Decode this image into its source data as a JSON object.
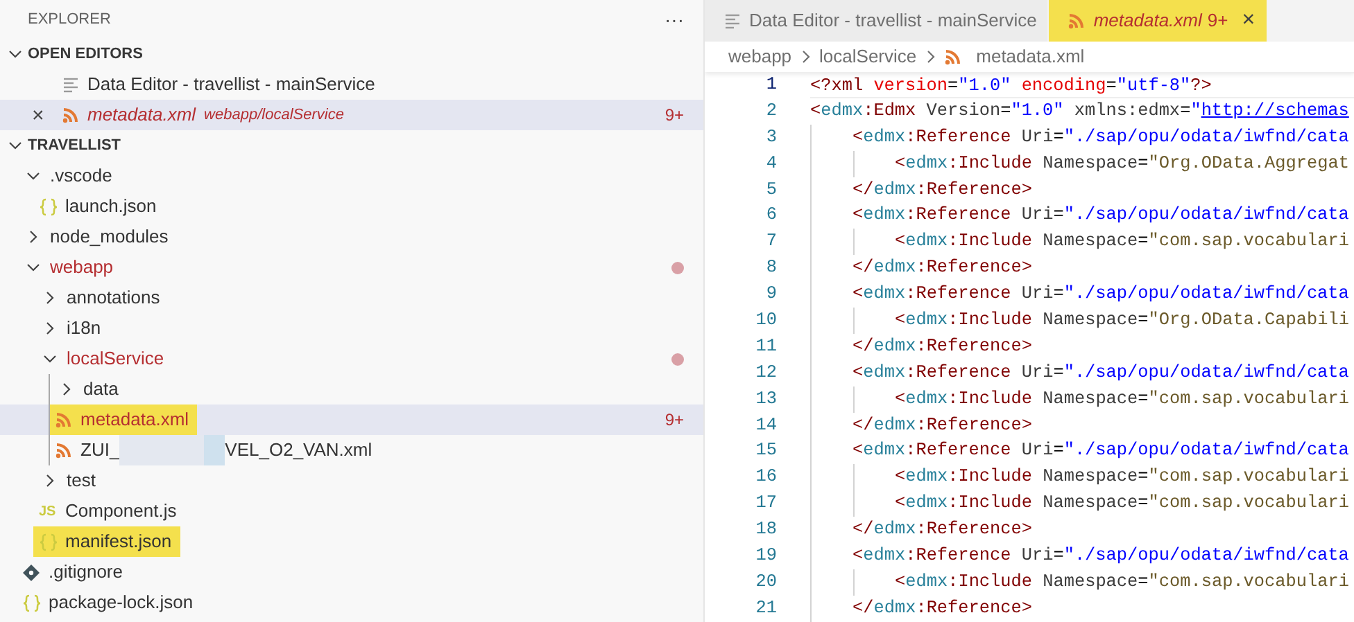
{
  "sidebar": {
    "title": "EXPLORER",
    "more": "···",
    "open_editors": {
      "title": "OPEN EDITORS",
      "expanded": true,
      "items": [
        {
          "label": "Data Editor - travellist - mainService",
          "kind": "data_editor",
          "selected": false,
          "italic": false,
          "problem": false
        },
        {
          "label": "metadata.xml",
          "description": "webapp/localService",
          "badge": "9+",
          "kind": "xml",
          "selected": true,
          "italic": true,
          "problem": true,
          "close": "×"
        }
      ]
    },
    "project": {
      "title": "TRAVELLIST",
      "expanded": true,
      "items": [
        {
          "label": ".vscode",
          "kind": "folder",
          "expanded": true,
          "children": [
            {
              "label": "launch.json",
              "kind": "json"
            }
          ]
        },
        {
          "label": "node_modules",
          "kind": "folder",
          "expanded": false
        },
        {
          "label": "webapp",
          "kind": "folder",
          "expanded": true,
          "problem": true,
          "modified": true,
          "children": [
            {
              "label": "annotations",
              "kind": "folder",
              "expanded": false
            },
            {
              "label": "i18n",
              "kind": "folder",
              "expanded": false
            },
            {
              "label": "localService",
              "kind": "folder",
              "expanded": true,
              "problem": true,
              "modified": true,
              "children": [
                {
                  "label": "data",
                  "kind": "folder",
                  "expanded": false
                },
                {
                  "label": "metadata.xml",
                  "kind": "xml",
                  "problem": true,
                  "selected": true,
                  "highlighted": true,
                  "badge": "9+"
                },
                {
                  "label": "ZUI_",
                  "label_after_redaction": "VEL_O2_VAN.xml",
                  "redacted": true,
                  "kind": "xml"
                }
              ]
            },
            {
              "label": "test",
              "kind": "folder",
              "expanded": false
            },
            {
              "label": "Component.js",
              "kind": "js",
              "icon_text": "JS"
            },
            {
              "label": "manifest.json",
              "kind": "json",
              "highlighted": true
            }
          ]
        },
        {
          "label": ".gitignore",
          "kind": "git"
        },
        {
          "label": "package-lock.json",
          "kind": "json"
        }
      ]
    }
  },
  "tabs": [
    {
      "label": "Data Editor - travellist - mainService",
      "kind": "data_editor",
      "selected": false
    },
    {
      "label": "metadata.xml",
      "badge": "9+",
      "kind": "xml",
      "selected": true,
      "italic": true,
      "highlighted": true,
      "close": "×"
    }
  ],
  "breadcrumb": [
    {
      "label": "webapp",
      "kind": "folder"
    },
    {
      "label": "localService",
      "kind": "folder"
    },
    {
      "label": "metadata.xml",
      "kind": "xml"
    }
  ],
  "editor": {
    "lines": [
      {
        "number": "1",
        "current": true,
        "kind": "root",
        "tokens": [
          {
            "kind": "br",
            "text": "<?"
          },
          {
            "kind": "tag",
            "text": "xml"
          },
          {
            "kind": "attr",
            "text": " version"
          },
          {
            "kind": "eq",
            "text": "="
          },
          {
            "kind": "str",
            "text": "\"1.0\""
          },
          {
            "kind": "attr",
            "text": " encoding"
          },
          {
            "kind": "eq",
            "text": "="
          },
          {
            "kind": "str",
            "text": "\"utf-8\""
          },
          {
            "kind": "br",
            "text": "?>"
          }
        ]
      },
      {
        "number": "2",
        "current": false,
        "kind": "root",
        "tokens": [
          {
            "kind": "pun",
            "text": "<"
          },
          {
            "kind": "ns",
            "text": "edmx"
          },
          {
            "kind": "tag",
            "text": ":Edmx"
          },
          {
            "kind": "attr2",
            "text": " Version"
          },
          {
            "kind": "eq",
            "text": "="
          },
          {
            "kind": "str",
            "text": "\"1.0\""
          },
          {
            "kind": "attr2",
            "text": " xmlns:edmx"
          },
          {
            "kind": "eq",
            "text": "="
          },
          {
            "kind": "str",
            "text": "\""
          },
          {
            "kind": "link",
            "text": "http://schemas"
          }
        ]
      },
      {
        "number": "3",
        "current": false,
        "kind": "nested",
        "tokens": [
          {
            "kind": "pun",
            "text": "<"
          },
          {
            "kind": "ns",
            "text": "edmx"
          },
          {
            "kind": "tag",
            "text": ":Reference"
          },
          {
            "kind": "attr2",
            "text": " Uri"
          },
          {
            "kind": "eq",
            "text": "="
          },
          {
            "kind": "str",
            "text": "\"./sap/opu/odata/iwfnd/cata"
          }
        ]
      },
      {
        "number": "4",
        "current": false,
        "kind": "nested2",
        "tokens": [
          {
            "kind": "pun",
            "text": "<"
          },
          {
            "kind": "ns",
            "text": "edmx"
          },
          {
            "kind": "tag",
            "text": ":Include"
          },
          {
            "kind": "attr2",
            "text": " Namespace"
          },
          {
            "kind": "eq",
            "text": "="
          },
          {
            "kind": "str2",
            "text": "\"Org.OData.Aggregat"
          }
        ]
      },
      {
        "number": "5",
        "current": false,
        "kind": "nested",
        "tokens": [
          {
            "kind": "pun",
            "text": "</"
          },
          {
            "kind": "ns",
            "text": "edmx"
          },
          {
            "kind": "tag",
            "text": ":Reference"
          },
          {
            "kind": "pun",
            "text": ">"
          }
        ]
      },
      {
        "number": "6",
        "current": false,
        "kind": "nested",
        "tokens": [
          {
            "kind": "pun",
            "text": "<"
          },
          {
            "kind": "ns",
            "text": "edmx"
          },
          {
            "kind": "tag",
            "text": ":Reference"
          },
          {
            "kind": "attr2",
            "text": " Uri"
          },
          {
            "kind": "eq",
            "text": "="
          },
          {
            "kind": "str",
            "text": "\"./sap/opu/odata/iwfnd/cata"
          }
        ]
      },
      {
        "number": "7",
        "current": false,
        "kind": "nested2",
        "tokens": [
          {
            "kind": "pun",
            "text": "<"
          },
          {
            "kind": "ns",
            "text": "edmx"
          },
          {
            "kind": "tag",
            "text": ":Include"
          },
          {
            "kind": "attr2",
            "text": " Namespace"
          },
          {
            "kind": "eq",
            "text": "="
          },
          {
            "kind": "str2",
            "text": "\"com.sap.vocabulari"
          }
        ]
      },
      {
        "number": "8",
        "current": false,
        "kind": "nested",
        "tokens": [
          {
            "kind": "pun",
            "text": "</"
          },
          {
            "kind": "ns",
            "text": "edmx"
          },
          {
            "kind": "tag",
            "text": ":Reference"
          },
          {
            "kind": "pun",
            "text": ">"
          }
        ]
      },
      {
        "number": "9",
        "current": false,
        "kind": "nested",
        "tokens": [
          {
            "kind": "pun",
            "text": "<"
          },
          {
            "kind": "ns",
            "text": "edmx"
          },
          {
            "kind": "tag",
            "text": ":Reference"
          },
          {
            "kind": "attr2",
            "text": " Uri"
          },
          {
            "kind": "eq",
            "text": "="
          },
          {
            "kind": "str",
            "text": "\"./sap/opu/odata/iwfnd/cata"
          }
        ]
      },
      {
        "number": "10",
        "current": false,
        "kind": "nested2",
        "tokens": [
          {
            "kind": "pun",
            "text": "<"
          },
          {
            "kind": "ns",
            "text": "edmx"
          },
          {
            "kind": "tag",
            "text": ":Include"
          },
          {
            "kind": "attr2",
            "text": " Namespace"
          },
          {
            "kind": "eq",
            "text": "="
          },
          {
            "kind": "str2",
            "text": "\"Org.OData.Capabili"
          }
        ]
      },
      {
        "number": "11",
        "current": false,
        "kind": "nested",
        "tokens": [
          {
            "kind": "pun",
            "text": "</"
          },
          {
            "kind": "ns",
            "text": "edmx"
          },
          {
            "kind": "tag",
            "text": ":Reference"
          },
          {
            "kind": "pun",
            "text": ">"
          }
        ]
      },
      {
        "number": "12",
        "current": false,
        "kind": "nested",
        "tokens": [
          {
            "kind": "pun",
            "text": "<"
          },
          {
            "kind": "ns",
            "text": "edmx"
          },
          {
            "kind": "tag",
            "text": ":Reference"
          },
          {
            "kind": "attr2",
            "text": " Uri"
          },
          {
            "kind": "eq",
            "text": "="
          },
          {
            "kind": "str",
            "text": "\"./sap/opu/odata/iwfnd/cata"
          }
        ]
      },
      {
        "number": "13",
        "current": false,
        "kind": "nested2",
        "tokens": [
          {
            "kind": "pun",
            "text": "<"
          },
          {
            "kind": "ns",
            "text": "edmx"
          },
          {
            "kind": "tag",
            "text": ":Include"
          },
          {
            "kind": "attr2",
            "text": " Namespace"
          },
          {
            "kind": "eq",
            "text": "="
          },
          {
            "kind": "str2",
            "text": "\"com.sap.vocabulari"
          }
        ]
      },
      {
        "number": "14",
        "current": false,
        "kind": "nested",
        "tokens": [
          {
            "kind": "pun",
            "text": "</"
          },
          {
            "kind": "ns",
            "text": "edmx"
          },
          {
            "kind": "tag",
            "text": ":Reference"
          },
          {
            "kind": "pun",
            "text": ">"
          }
        ]
      },
      {
        "number": "15",
        "current": false,
        "kind": "nested",
        "tokens": [
          {
            "kind": "pun",
            "text": "<"
          },
          {
            "kind": "ns",
            "text": "edmx"
          },
          {
            "kind": "tag",
            "text": ":Reference"
          },
          {
            "kind": "attr2",
            "text": " Uri"
          },
          {
            "kind": "eq",
            "text": "="
          },
          {
            "kind": "str",
            "text": "\"./sap/opu/odata/iwfnd/cata"
          }
        ]
      },
      {
        "number": "16",
        "current": false,
        "kind": "nested2",
        "tokens": [
          {
            "kind": "pun",
            "text": "<"
          },
          {
            "kind": "ns",
            "text": "edmx"
          },
          {
            "kind": "tag",
            "text": ":Include"
          },
          {
            "kind": "attr2",
            "text": " Namespace"
          },
          {
            "kind": "eq",
            "text": "="
          },
          {
            "kind": "str2",
            "text": "\"com.sap.vocabulari"
          }
        ]
      },
      {
        "number": "17",
        "current": false,
        "kind": "nested2",
        "tokens": [
          {
            "kind": "pun",
            "text": "<"
          },
          {
            "kind": "ns",
            "text": "edmx"
          },
          {
            "kind": "tag",
            "text": ":Include"
          },
          {
            "kind": "attr2",
            "text": " Namespace"
          },
          {
            "kind": "eq",
            "text": "="
          },
          {
            "kind": "str2",
            "text": "\"com.sap.vocabulari"
          }
        ]
      },
      {
        "number": "18",
        "current": false,
        "kind": "nested",
        "tokens": [
          {
            "kind": "pun",
            "text": "</"
          },
          {
            "kind": "ns",
            "text": "edmx"
          },
          {
            "kind": "tag",
            "text": ":Reference"
          },
          {
            "kind": "pun",
            "text": ">"
          }
        ]
      },
      {
        "number": "19",
        "current": false,
        "kind": "nested",
        "tokens": [
          {
            "kind": "pun",
            "text": "<"
          },
          {
            "kind": "ns",
            "text": "edmx"
          },
          {
            "kind": "tag",
            "text": ":Reference"
          },
          {
            "kind": "attr2",
            "text": " Uri"
          },
          {
            "kind": "eq",
            "text": "="
          },
          {
            "kind": "str",
            "text": "\"./sap/opu/odata/iwfnd/cata"
          }
        ]
      },
      {
        "number": "20",
        "current": false,
        "kind": "nested2",
        "tokens": [
          {
            "kind": "pun",
            "text": "<"
          },
          {
            "kind": "ns",
            "text": "edmx"
          },
          {
            "kind": "tag",
            "text": ":Include"
          },
          {
            "kind": "attr2",
            "text": " Namespace"
          },
          {
            "kind": "eq",
            "text": "="
          },
          {
            "kind": "str2",
            "text": "\"com.sap.vocabulari"
          }
        ]
      },
      {
        "number": "21",
        "current": false,
        "kind": "nested",
        "tokens": [
          {
            "kind": "pun",
            "text": "</"
          },
          {
            "kind": "ns",
            "text": "edmx"
          },
          {
            "kind": "tag",
            "text": ":Reference"
          },
          {
            "kind": "pun",
            "text": ">"
          }
        ]
      }
    ]
  }
}
